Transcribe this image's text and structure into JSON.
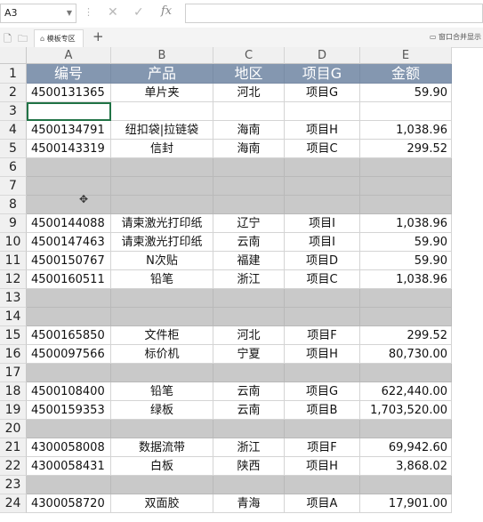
{
  "formula_bar": {
    "name_box": "A3",
    "fx_label": "fx",
    "formula_value": ""
  },
  "tabbar": {
    "tab_label": "模板专区",
    "add_label": "+",
    "right_tool_label": "窗口合并显示"
  },
  "columns": [
    "A",
    "B",
    "C",
    "D",
    "E"
  ],
  "rows": [
    {
      "n": "1",
      "type": "header",
      "cells": [
        "编号",
        "产品",
        "地区",
        "项目G",
        "金额"
      ]
    },
    {
      "n": "2",
      "type": "data",
      "cells": [
        "4500131365",
        "单片夹",
        "河北",
        "项目G",
        "59.90"
      ]
    },
    {
      "n": "3",
      "type": "blank",
      "cells": [
        "",
        "",
        "",
        "",
        ""
      ]
    },
    {
      "n": "4",
      "type": "data",
      "cells": [
        "4500134791",
        "纽扣袋|拉链袋",
        "海南",
        "项目H",
        "1,038.96"
      ]
    },
    {
      "n": "5",
      "type": "data",
      "cells": [
        "4500143319",
        "信封",
        "海南",
        "项目C",
        "299.52"
      ]
    },
    {
      "n": "6",
      "type": "gray",
      "cells": [
        "",
        "",
        "",
        "",
        ""
      ]
    },
    {
      "n": "7",
      "type": "gray",
      "cells": [
        "",
        "",
        "",
        "",
        ""
      ]
    },
    {
      "n": "8",
      "type": "gray",
      "cells": [
        "",
        "",
        "",
        "",
        ""
      ]
    },
    {
      "n": "9",
      "type": "data",
      "cells": [
        "4500144088",
        "请柬激光打印纸",
        "辽宁",
        "项目I",
        "1,038.96"
      ]
    },
    {
      "n": "10",
      "type": "data",
      "cells": [
        "4500147463",
        "请柬激光打印纸",
        "云南",
        "项目I",
        "59.90"
      ]
    },
    {
      "n": "11",
      "type": "data",
      "cells": [
        "4500150767",
        "N次贴",
        "福建",
        "项目D",
        "59.90"
      ]
    },
    {
      "n": "12",
      "type": "data",
      "cells": [
        "4500160511",
        "铅笔",
        "浙江",
        "项目C",
        "1,038.96"
      ]
    },
    {
      "n": "13",
      "type": "gray",
      "cells": [
        "",
        "",
        "",
        "",
        ""
      ]
    },
    {
      "n": "14",
      "type": "gray",
      "cells": [
        "",
        "",
        "",
        "",
        ""
      ]
    },
    {
      "n": "15",
      "type": "data",
      "cells": [
        "4500165850",
        "文件柜",
        "河北",
        "项目F",
        "299.52"
      ]
    },
    {
      "n": "16",
      "type": "data",
      "cells": [
        "4500097566",
        "标价机",
        "宁夏",
        "项目H",
        "80,730.00"
      ]
    },
    {
      "n": "17",
      "type": "gray",
      "cells": [
        "",
        "",
        "",
        "",
        ""
      ]
    },
    {
      "n": "18",
      "type": "data",
      "cells": [
        "4500108400",
        "铅笔",
        "云南",
        "项目G",
        "622,440.00"
      ]
    },
    {
      "n": "19",
      "type": "data",
      "cells": [
        "4500159353",
        "绿板",
        "云南",
        "项目B",
        "1,703,520.00"
      ]
    },
    {
      "n": "20",
      "type": "gray",
      "cells": [
        "",
        "",
        "",
        "",
        ""
      ]
    },
    {
      "n": "21",
      "type": "data",
      "cells": [
        "4300058008",
        "数据流带",
        "浙江",
        "项目F",
        "69,942.60"
      ]
    },
    {
      "n": "22",
      "type": "data",
      "cells": [
        "4300058431",
        "白板",
        "陕西",
        "项目H",
        "3,868.02"
      ]
    },
    {
      "n": "23",
      "type": "gray",
      "cells": [
        "",
        "",
        "",
        "",
        ""
      ]
    },
    {
      "n": "24",
      "type": "data",
      "cells": [
        "4300058720",
        "双面胶",
        "青海",
        "项目A",
        "17,901.00"
      ]
    }
  ]
}
